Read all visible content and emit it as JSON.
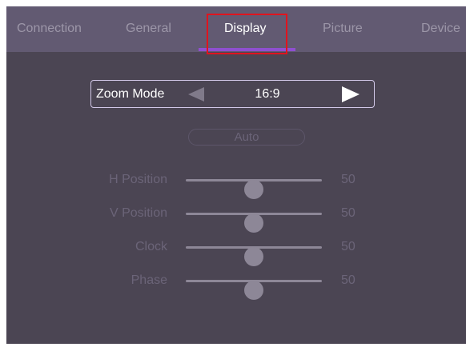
{
  "tabs": [
    {
      "label": "Connection",
      "active": false
    },
    {
      "label": "General",
      "active": false
    },
    {
      "label": "Display",
      "active": true
    },
    {
      "label": "Picture",
      "active": false
    },
    {
      "label": "Device",
      "active": false
    }
  ],
  "zoom": {
    "label": "Zoom Mode",
    "value": "16:9",
    "left_arrow_icon": "triangle-left",
    "right_arrow_icon": "triangle-right"
  },
  "auto_button": {
    "label": "Auto",
    "enabled": false
  },
  "sliders": [
    {
      "label": "H Position",
      "value": "50",
      "level": 0.5
    },
    {
      "label": "V Position",
      "value": "50",
      "level": 0.5
    },
    {
      "label": "Clock",
      "value": "50",
      "level": 0.5
    },
    {
      "label": "Phase",
      "value": "50",
      "level": 0.5
    }
  ],
  "colors": {
    "background": "#4b4553",
    "tab_bar": "#625a72",
    "accent_underline": "#8f4fd0",
    "highlight_box": "#e0141e",
    "disabled_text": "#6b6478"
  }
}
